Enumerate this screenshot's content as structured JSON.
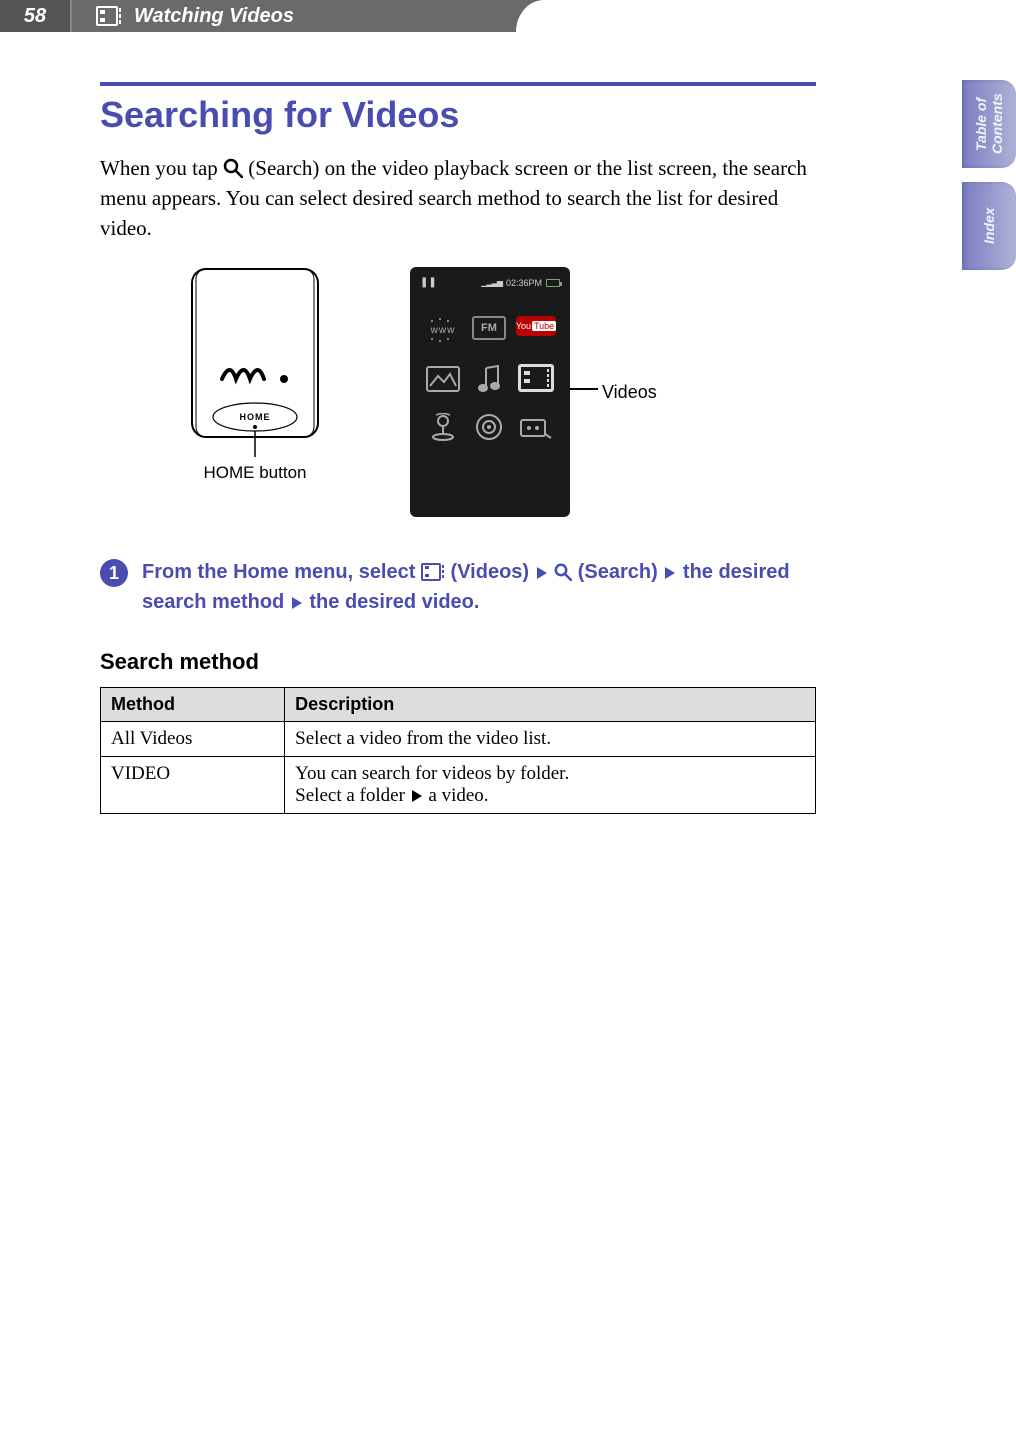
{
  "header": {
    "page_number": "58",
    "section_title": "Watching Videos"
  },
  "heading": "Searching for Videos",
  "intro": {
    "pre": "When you tap ",
    "search_label": " (Search) on the video playback screen or the list screen, the search menu appears. You can select desired search method to search the list for desired video."
  },
  "figures": {
    "home_button_caption": "HOME button",
    "screen_time": "02:36PM",
    "fm_label": "FM",
    "yt_a": "You",
    "yt_b": "Tube",
    "videos_callout": "Videos"
  },
  "step": {
    "number": "1",
    "t1": "From the Home menu, select ",
    "t2": " (Videos) ",
    "t3": " (Search) ",
    "t4": " the desired search method ",
    "t5": " the desired video."
  },
  "subheading": "Search method",
  "table": {
    "col_method": "Method",
    "col_desc": "Description",
    "rows": [
      {
        "method": "All Videos",
        "desc": "Select a video from the video list."
      },
      {
        "method": "VIDEO",
        "desc_a": "You can search for videos by folder.",
        "desc_b_pre": "Select a folder ",
        "desc_b_post": " a video."
      }
    ]
  },
  "side_tabs": {
    "toc": "Table of\nContents",
    "index": "Index"
  }
}
